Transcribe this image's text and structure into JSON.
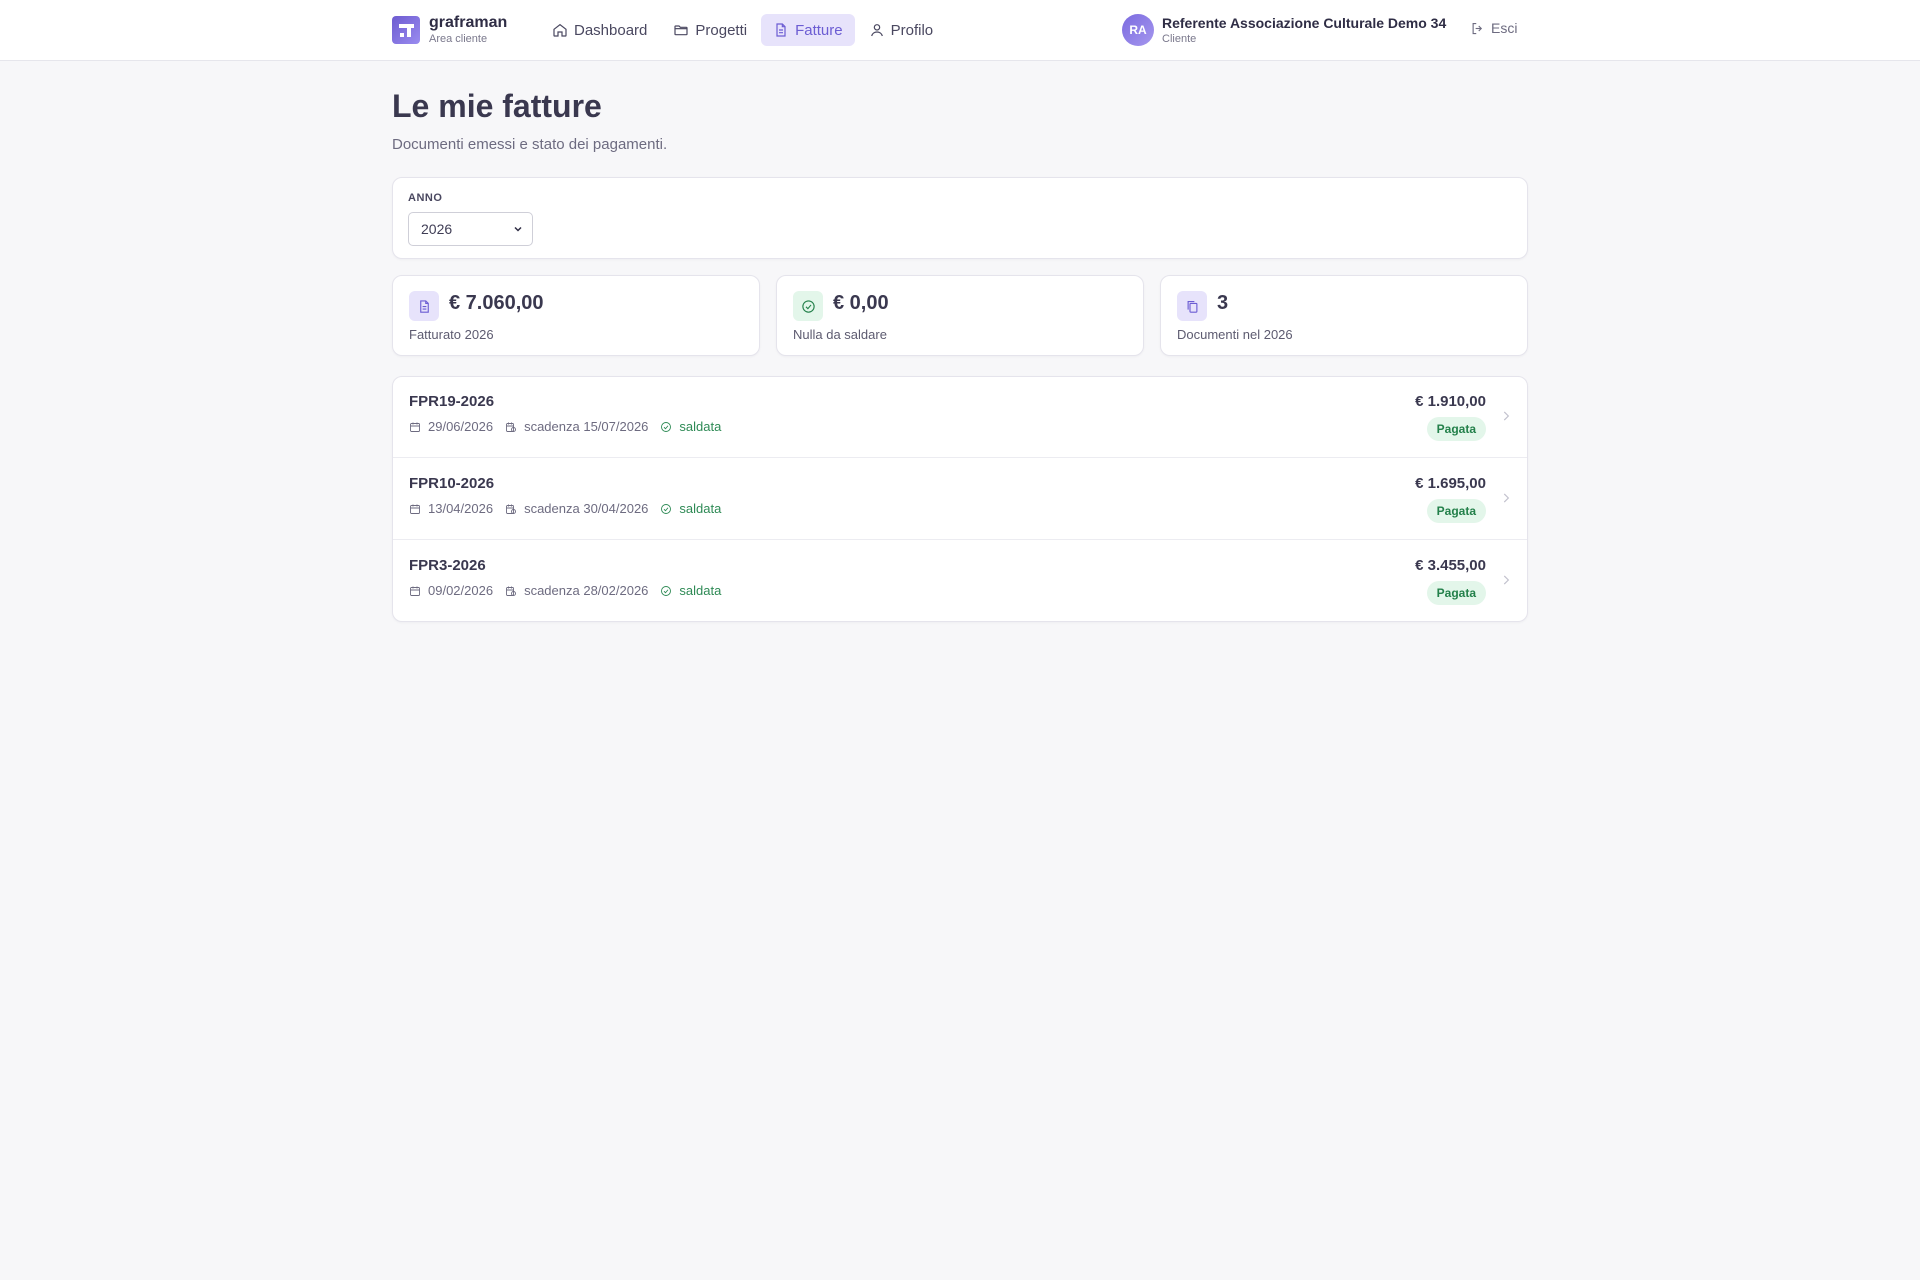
{
  "brand": {
    "name": "graframan",
    "subtitle": "Area cliente"
  },
  "nav": {
    "items": [
      {
        "label": "Dashboard",
        "icon": "home-icon",
        "active": false
      },
      {
        "label": "Progetti",
        "icon": "folder-icon",
        "active": false
      },
      {
        "label": "Fatture",
        "icon": "document-icon",
        "active": true
      },
      {
        "label": "Profilo",
        "icon": "user-icon",
        "active": false
      }
    ]
  },
  "user": {
    "initials": "RA",
    "name": "Referente Associazione Culturale Demo 34",
    "role": "Cliente",
    "logout_label": "Esci"
  },
  "page": {
    "title": "Le mie fatture",
    "subtitle": "Documenti emessi e stato dei pagamenti."
  },
  "filter": {
    "label": "ANNO",
    "selected_year": "2026"
  },
  "stats": [
    {
      "icon": "document-icon",
      "value": "€ 7.060,00",
      "label": "Fatturato 2026",
      "icon_bg": "#e7e3fb",
      "icon_color": "#6c5dd3"
    },
    {
      "icon": "check-circle-icon",
      "value": "€ 0,00",
      "label": "Nulla da saldare",
      "icon_bg": "#e3f6ea",
      "icon_color": "#23804a"
    },
    {
      "icon": "copy-icon",
      "value": "3",
      "label": "Documenti nel 2026",
      "icon_bg": "#e7e3fb",
      "icon_color": "#6c5dd3"
    }
  ],
  "invoices": [
    {
      "number": "FPR19-2026",
      "date": "29/06/2026",
      "due": "scadenza 15/07/2026",
      "payment": "saldata",
      "amount": "€ 1.910,00",
      "status": "Pagata"
    },
    {
      "number": "FPR10-2026",
      "date": "13/04/2026",
      "due": "scadenza 30/04/2026",
      "payment": "saldata",
      "amount": "€ 1.695,00",
      "status": "Pagata"
    },
    {
      "number": "FPR3-2026",
      "date": "09/02/2026",
      "due": "scadenza 28/02/2026",
      "payment": "saldata",
      "amount": "€ 3.455,00",
      "status": "Pagata"
    }
  ],
  "colors": {
    "accent": "#6c5dd3",
    "success": "#23804a",
    "background": "#f7f7f9"
  }
}
